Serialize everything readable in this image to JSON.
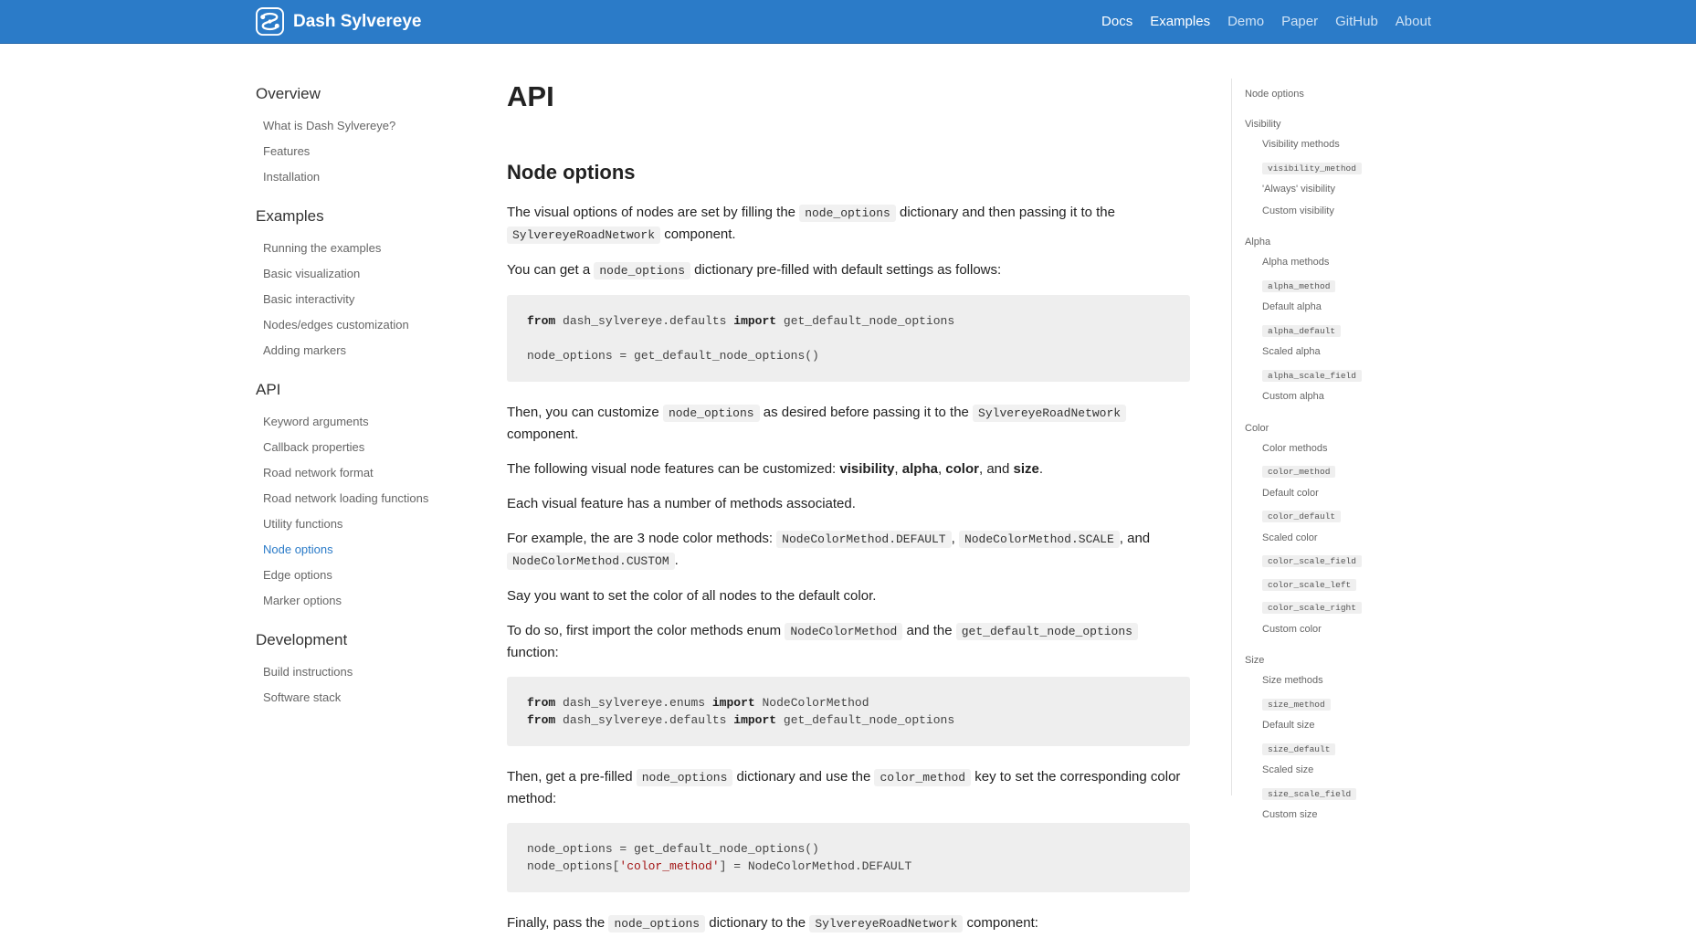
{
  "brand": {
    "title": "Dash Sylvereye"
  },
  "nav": [
    "Docs",
    "Examples",
    "Demo",
    "Paper",
    "GitHub",
    "About"
  ],
  "sidebar": {
    "sections": [
      {
        "title": "Overview",
        "items": [
          "What is Dash Sylvereye?",
          "Features",
          "Installation"
        ]
      },
      {
        "title": "Examples",
        "items": [
          "Running the examples",
          "Basic visualization",
          "Basic interactivity",
          "Nodes/edges customization",
          "Adding markers"
        ]
      },
      {
        "title": "API",
        "items": [
          "Keyword arguments",
          "Callback properties",
          "Road network format",
          "Road network loading functions",
          "Utility functions",
          "Node options",
          "Edge options",
          "Marker options"
        ]
      },
      {
        "title": "Development",
        "items": [
          "Build instructions",
          "Software stack"
        ]
      }
    ],
    "current_item": "Node options"
  },
  "content": {
    "title": "API",
    "section": "Node options",
    "p1": {
      "a": "The visual options of nodes are set by filling the",
      "c1": "node_options",
      "b": "dictionary and then passing it to the",
      "c2": "SylvereyeRoadNetwork",
      "c": "component."
    },
    "p2": {
      "a": "You can get a",
      "c1": "node_options",
      "b": "dictionary pre-filled with default settings as follows:"
    },
    "code1": {
      "kw_from": "from",
      "mod": "dash_sylvereye.defaults",
      "kw_import": "import",
      "name": "get_default_node_options",
      "line2": "node_options = get_default_node_options()"
    },
    "p3": {
      "a": "Then, you can customize",
      "c1": "node_options",
      "b": "as desired before passing it to the",
      "c2": "SylvereyeRoadNetwork",
      "c": "component."
    },
    "p4": {
      "a": "The following visual node features can be customized:",
      "f1": "visibility",
      "f2": "alpha",
      "f3": "color",
      "and": "and",
      "f4": "size"
    },
    "p5": "Each visual feature has a number of methods associated.",
    "p6": {
      "a": "For example, the are 3 node color methods:",
      "c1": "NodeColorMethod.DEFAULT",
      "c2": "NodeColorMethod.SCALE",
      "and": ", and",
      "c3": "NodeColorMethod.CUSTOM"
    },
    "p7": "Say you want to set the color of all nodes to the default color.",
    "p8": {
      "a": "To do so, first import the color methods enum",
      "c1": "NodeColorMethod",
      "b": "and the",
      "c2": "get_default_node_options",
      "c": "function:"
    },
    "code2": {
      "l1": {
        "kw_from": "from",
        "mod": "dash_sylvereye.enums",
        "kw_import": "import",
        "name": "NodeColorMethod"
      },
      "l2": {
        "kw_from": "from",
        "mod": "dash_sylvereye.defaults",
        "kw_import": "import",
        "name": "get_default_node_options"
      }
    },
    "p9": {
      "a": "Then, get a pre-filled",
      "c1": "node_options",
      "b": "dictionary and use the",
      "c2": "color_method",
      "c": "key to set the corresponding color method:"
    },
    "code3": {
      "line1": "node_options = get_default_node_options()",
      "l2a": "node_options[",
      "l2str": "'color_method'",
      "l2b": "] = NodeColorMethod.DEFAULT"
    },
    "p10": {
      "a": "Finally, pass the",
      "c1": "node_options",
      "b": "dictionary to the",
      "c2": "SylvereyeRoadNetwork",
      "c": "component:"
    }
  },
  "toc": {
    "node_options": "Node options",
    "visibility": {
      "title": "Visibility",
      "methods": "Visibility methods",
      "code": "visibility_method",
      "always": "'Always' visibility",
      "custom": "Custom visibility"
    },
    "alpha": {
      "title": "Alpha",
      "methods": "Alpha methods",
      "code1": "alpha_method",
      "default": "Default alpha",
      "code2": "alpha_default",
      "scaled": "Scaled alpha",
      "code3": "alpha_scale_field",
      "custom": "Custom alpha"
    },
    "color": {
      "title": "Color",
      "methods": "Color methods",
      "code1": "color_method",
      "default": "Default color",
      "code2": "color_default",
      "scaled": "Scaled color",
      "code3": "color_scale_field",
      "code4": "color_scale_left",
      "code5": "color_scale_right",
      "custom": "Custom color"
    },
    "size": {
      "title": "Size",
      "methods": "Size methods",
      "code1": "size_method",
      "default": "Default size",
      "code2": "size_default",
      "scaled": "Scaled size",
      "code3": "size_scale_field",
      "custom": "Custom size"
    }
  },
  "colors": {
    "navbar": "#2b7bc8",
    "link_active": "#2b7bc8",
    "code_bg": "#eeeeee"
  }
}
